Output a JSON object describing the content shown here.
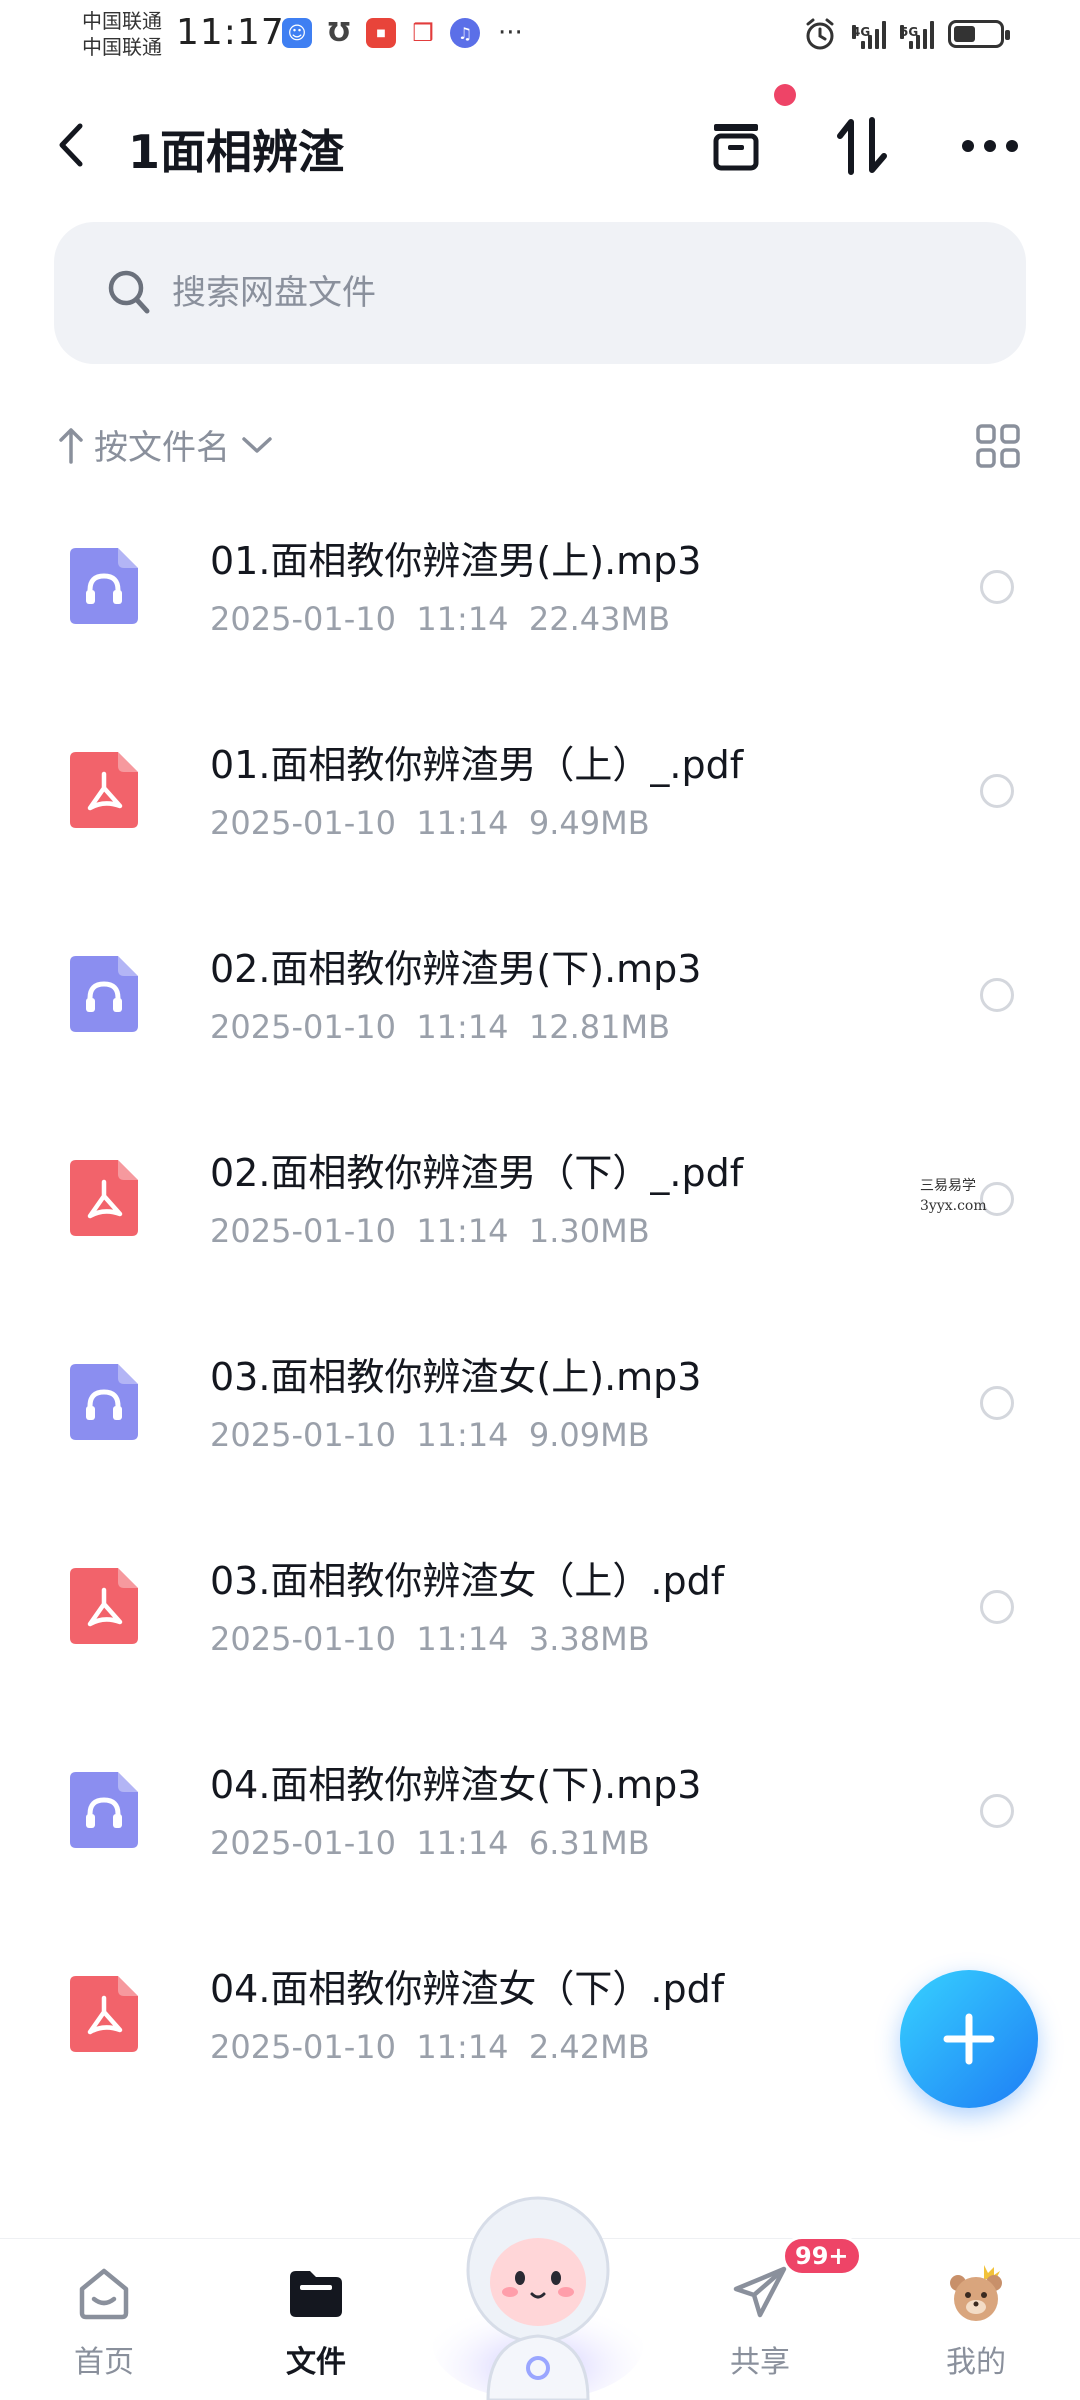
{
  "status_bar": {
    "carrier_1": "中国联通",
    "carrier_2": "中国联通",
    "time": "11:17",
    "more": "···",
    "network_1": "4G",
    "network_2": "5G",
    "battery_percent": 45,
    "notification_icons": [
      "app-badge-icon",
      "u-icon",
      "huawei-icon",
      "book-icon",
      "music-icon"
    ]
  },
  "header": {
    "title": "1面相辨渣",
    "icons": [
      "back-icon",
      "transfer-box-icon",
      "sort-arrows-icon",
      "more-icon"
    ]
  },
  "search": {
    "placeholder": "搜索网盘文件"
  },
  "sort": {
    "label": "按文件名"
  },
  "files": [
    {
      "name": "01.面相教你辨渣男(上).mp3",
      "date": "2025-01-10",
      "time": "11:14",
      "size": "22.43MB",
      "type": "audio"
    },
    {
      "name": "01.面相教你辨渣男（上）_.pdf",
      "date": "2025-01-10",
      "time": "11:14",
      "size": "9.49MB",
      "type": "pdf"
    },
    {
      "name": "02.面相教你辨渣男(下).mp3",
      "date": "2025-01-10",
      "time": "11:14",
      "size": "12.81MB",
      "type": "audio"
    },
    {
      "name": "02.面相教你辨渣男（下）_.pdf",
      "date": "2025-01-10",
      "time": "11:14",
      "size": "1.30MB",
      "type": "pdf"
    },
    {
      "name": "03.面相教你辨渣女(上).mp3",
      "date": "2025-01-10",
      "time": "11:14",
      "size": "9.09MB",
      "type": "audio"
    },
    {
      "name": "03.面相教你辨渣女（上）.pdf",
      "date": "2025-01-10",
      "time": "11:14",
      "size": "3.38MB",
      "type": "pdf"
    },
    {
      "name": "04.面相教你辨渣女(下).mp3",
      "date": "2025-01-10",
      "time": "11:14",
      "size": "6.31MB",
      "type": "audio"
    },
    {
      "name": "04.面相教你辨渣女（下）.pdf",
      "date": "2025-01-10",
      "time": "11:14",
      "size": "2.42MB",
      "type": "pdf"
    }
  ],
  "watermark": {
    "line1": "三易易学",
    "line2": "3yyx.com"
  },
  "bottom_nav": {
    "home": "首页",
    "files": "文件",
    "share": "共享",
    "mine": "我的",
    "share_badge": "99+"
  },
  "colors": {
    "audio_icon": "#8b8ef0",
    "pdf_icon": "#f2636b",
    "accent": "#1e7df5",
    "badge": "#ee4467"
  }
}
